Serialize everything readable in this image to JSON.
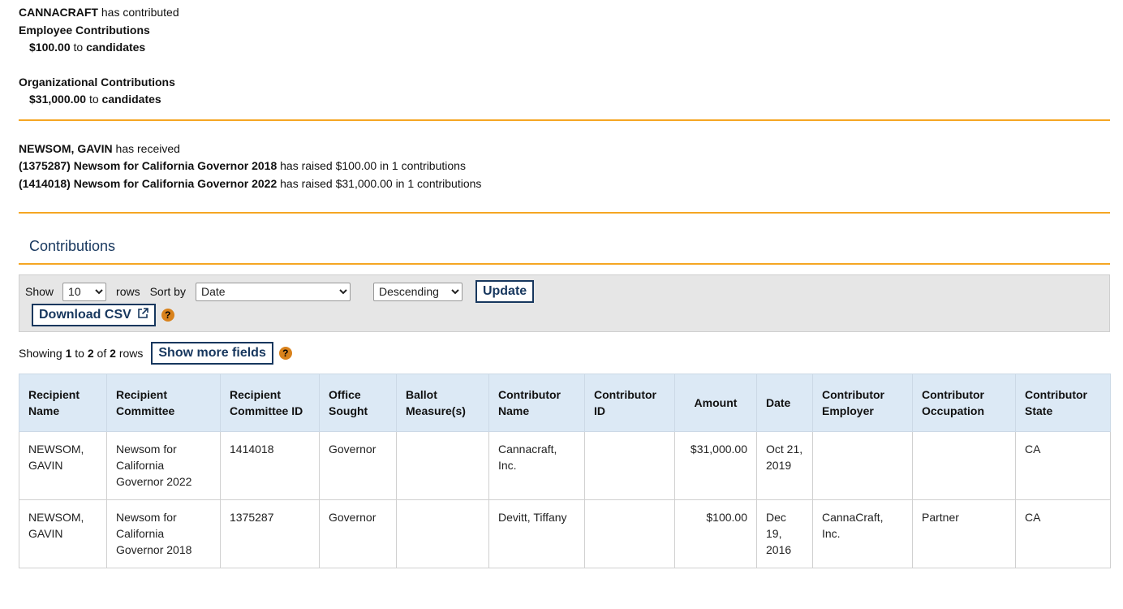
{
  "contributor_summary": {
    "name": "CANNACRAFT",
    "verb": "has contributed",
    "employee_heading": "Employee Contributions",
    "employee_amount": "$100.00",
    "employee_to": "to",
    "employee_target": "candidates",
    "org_heading": "Organizational Contributions",
    "org_amount": "$31,000.00",
    "org_to": "to",
    "org_target": "candidates"
  },
  "recipient_summary": {
    "name": "NEWSOM, GAVIN",
    "verb": "has received",
    "committees": [
      {
        "label": "(1375287) Newsom for California Governor 2018",
        "text": "has raised $100.00 in 1 contributions"
      },
      {
        "label": "(1414018) Newsom for California Governor 2022",
        "text": "has raised $31,000.00 in 1 contributions"
      }
    ]
  },
  "section_title": "Contributions",
  "controls": {
    "show_label": "Show",
    "rows_value": "10",
    "rows_label": "rows",
    "sort_label": "Sort by",
    "sort_value": "Date",
    "order_value": "Descending",
    "update_label": "Update",
    "download_label": "Download CSV",
    "help_glyph": "?"
  },
  "showing": {
    "prefix": "Showing",
    "from": "1",
    "to_word": "to",
    "to": "2",
    "of_word": "of",
    "total": "2",
    "suffix": "rows",
    "more_fields_label": "Show more fields",
    "help_glyph": "?"
  },
  "table": {
    "headers": [
      "Recipient Name",
      "Recipient Committee",
      "Recipient Committee ID",
      "Office Sought",
      "Ballot Measure(s)",
      "Contributor Name",
      "Contributor ID",
      "Amount",
      "Date",
      "Contributor Employer",
      "Contributor Occupation",
      "Contributor State"
    ],
    "rows": [
      [
        "NEWSOM, GAVIN",
        "Newsom for California Governor 2022",
        "1414018",
        "Governor",
        "",
        "Cannacraft, Inc.",
        "",
        "$31,000.00",
        "Oct 21, 2019",
        "",
        "",
        "CA"
      ],
      [
        "NEWSOM, GAVIN",
        "Newsom for California Governor 2018",
        "1375287",
        "Governor",
        "",
        "Devitt, Tiffany",
        "",
        "$100.00",
        "Dec 19, 2016",
        "CannaCraft, Inc.",
        "Partner",
        "CA"
      ]
    ]
  },
  "colors": {
    "accent_rule": "#f5a623",
    "brand_navy": "#17375e",
    "header_bg": "#dce9f5",
    "help_orange": "#d9821c"
  }
}
